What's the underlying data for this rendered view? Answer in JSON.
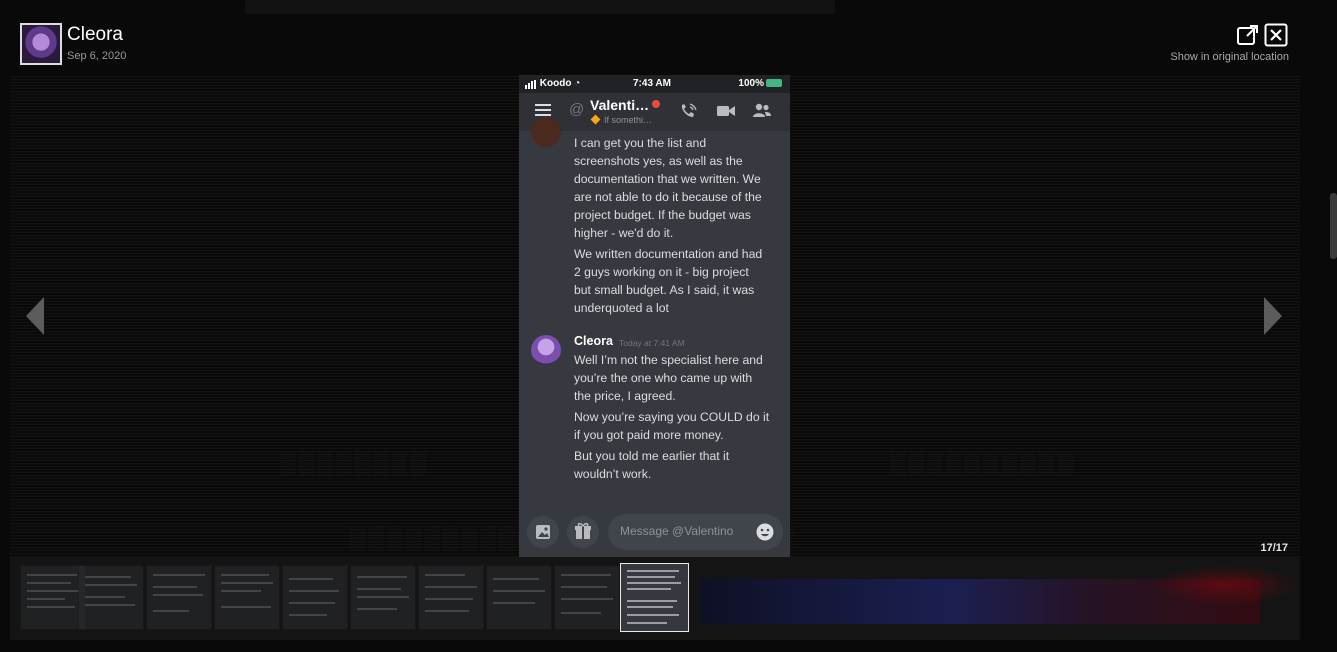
{
  "header": {
    "title": "Cleora",
    "date": "Sep 6, 2020",
    "show_original": "Show in original location"
  },
  "viewer": {
    "counter": "17/17"
  },
  "phone": {
    "carrier": "Koodo",
    "time": "7:43 AM",
    "battery": "100%",
    "dm_name": "Valenti…",
    "dm_status": "If somethi…",
    "messages_prev": [
      "I can get you the list and",
      "screenshots yes, as well as the",
      "documentation that we written. We",
      "are not able to do it because of the",
      "project budget. If the budget was",
      "higher - we'd do it.",
      "We written documentation and had",
      "2 guys working on it - big project",
      "but small budget. As I said, it was",
      "underquoted a lot"
    ],
    "author": "Cleora",
    "timestamp": "Today at 7:41 AM",
    "messages_cleora": [
      "Well I’m not the specialist here and",
      "you’re the one who came up with",
      "the price, I agreed.",
      "Now you’re saying you COULD do it",
      "if you got paid more money.",
      "But you told me earlier that it",
      "wouldn’t work."
    ],
    "composer_placeholder": "Message @Valentino"
  },
  "icons": {
    "open_external": "external-link-icon",
    "close": "close-icon",
    "prev": "chevron-left-icon",
    "next": "chevron-right-icon",
    "menu": "hamburger-icon",
    "call": "phone-icon",
    "video": "video-icon",
    "members": "members-icon",
    "image": "image-icon",
    "gift": "gift-icon",
    "emoji": "emoji-icon"
  },
  "colors": {
    "discord_bg": "#36393f",
    "discord_header": "#2f3136",
    "dnd_red": "#f04747",
    "online_green": "#43b581"
  }
}
